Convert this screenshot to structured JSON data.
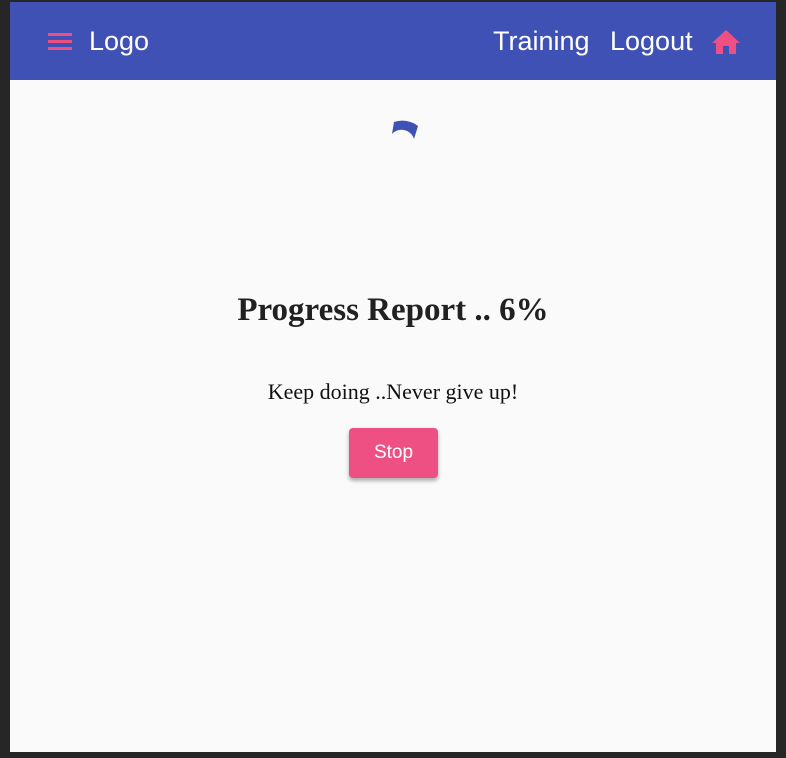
{
  "header": {
    "logo_text": "Logo",
    "nav": {
      "training_label": "Training",
      "logout_label": "Logout"
    },
    "icons": {
      "menu": "menu-icon",
      "home": "home-icon"
    }
  },
  "main": {
    "spinner": {
      "icon": "loading-spinner",
      "progress_fraction": 0.06
    },
    "title": "Progress Report .. 6%",
    "message": "Keep doing ..Never give up!",
    "stop_label": "Stop"
  },
  "colors": {
    "primary": "#3f51b5",
    "accent": "#ef5083",
    "background": "#fafafa",
    "text": "#212121"
  }
}
